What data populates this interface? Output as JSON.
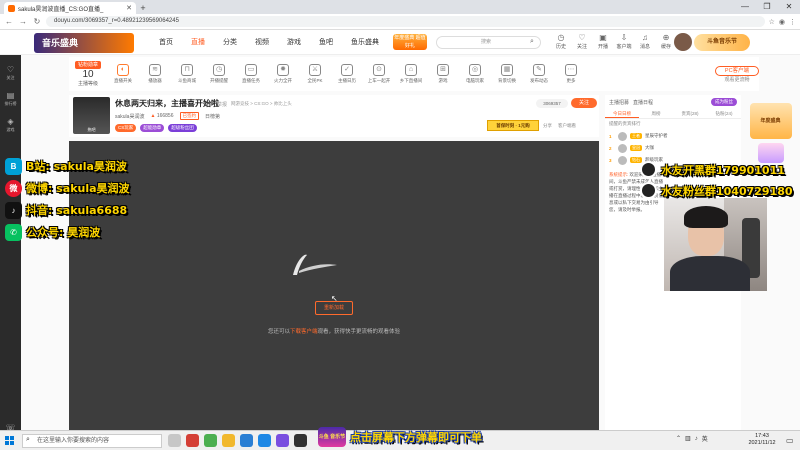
{
  "browser": {
    "tab_title": "sakula昊润波直播_CS:GO直播_",
    "url": "douyu.com/3069357_r=0.489212395690642​45",
    "window_controls": [
      "—",
      "❐",
      "✕"
    ]
  },
  "header": {
    "logo_text": "音乐盛典",
    "nav": [
      "首页",
      "直播",
      "分类",
      "视频",
      "游戏",
      "鱼吧",
      "鱼乐盛典"
    ],
    "promo": "年度盛典 超值好礼",
    "search_placeholder": "搜索",
    "icons": [
      {
        "label": "历史",
        "icon": "clock-icon"
      },
      {
        "label": "关注",
        "icon": "heart-icon"
      },
      {
        "label": "开播",
        "icon": "camera-icon"
      },
      {
        "label": "客户端",
        "icon": "download-icon"
      },
      {
        "label": "消息",
        "icon": "bell-icon"
      },
      {
        "label": "缓存",
        "icon": "cache-icon"
      }
    ],
    "banner": "斗鱼音乐节"
  },
  "leftbar": [
    {
      "label": "关注",
      "icon": "heart-icon"
    },
    {
      "label": "排行榜",
      "icon": "rank-icon"
    },
    {
      "label": "游戏",
      "icon": "game-icon"
    },
    {
      "label": "客服",
      "icon": "service-icon"
    }
  ],
  "toolrow": {
    "level_badge": "钻粉勋章",
    "level_num": "10",
    "level_sub": "主播等级",
    "tools": [
      {
        "label": "直播开关",
        "glyph": "◐",
        "warm": true
      },
      {
        "label": "播放器",
        "glyph": "≋",
        "warm": false
      },
      {
        "label": "斗鱼商城",
        "glyph": "⊓",
        "warm": false
      },
      {
        "label": "开播提醒",
        "glyph": "◷",
        "warm": false
      },
      {
        "label": "直播任务",
        "glyph": "▭",
        "warm": false
      },
      {
        "label": "火力全开",
        "glyph": "✹",
        "warm": false
      },
      {
        "label": "全民PK",
        "glyph": "⚔",
        "warm": false
      },
      {
        "label": "主播日历",
        "glyph": "✓",
        "warm": false
      },
      {
        "label": "上车一起开",
        "glyph": "⊙",
        "warm": false
      },
      {
        "label": "乡下直播间",
        "glyph": "⌂",
        "warm": false
      },
      {
        "label": "游戏",
        "glyph": "⊞",
        "warm": false
      },
      {
        "label": "电脑玩家",
        "glyph": "◎",
        "warm": false
      },
      {
        "label": "背景切换",
        "glyph": "▦",
        "warm": false
      },
      {
        "label": "发布动态",
        "glyph": "✎",
        "warm": false
      },
      {
        "label": "更多",
        "glyph": "⋯",
        "warm": false
      }
    ],
    "pc_button": "PC客户端",
    "pc_sub": "观看更流畅"
  },
  "room": {
    "avatar_label": "热吧",
    "title": "休息两天归来，主播喜开始啦",
    "report": "举报",
    "crumbs": "网游竞技 > CS:GO > 帅比上头",
    "streamer": "sakula昊润波",
    "hot": "166856",
    "verified": "已签约",
    "rank": "日榜第",
    "tags": [
      "CS玩家",
      "超能勋章",
      "超级粉丝团"
    ],
    "room_id": "3069357",
    "follow": "关注",
    "gift_banner": "首保时刻 · 1元购",
    "actions": [
      "分享",
      "客户端看"
    ]
  },
  "player": {
    "reload": "重新加载",
    "tip_prefix": "您还可以",
    "tip_link": "下载客户端",
    "tip_suffix": "观看，获得快手更流畅的观看体验"
  },
  "chat": {
    "top_label": "主播招募",
    "top_right": "直播日程",
    "fans_button": "成为粉丝",
    "tabs": [
      "今日日榜",
      "周榜",
      "贵宾(28)",
      "钻粉(24)"
    ],
    "rank_title": "提醒的贵宾排行",
    "ranks": [
      {
        "rank": "1",
        "name": "星辰守护者",
        "badge": "王者"
      },
      {
        "rank": "2",
        "name": "大咖",
        "badge": "皇冠"
      },
      {
        "rank": "3",
        "name": "超级玩家",
        "badge": "钻石"
      }
    ],
    "sys_label": "系统提示:",
    "sys_text": "欢迎来到本直播间，斗鱼严禁未成年人直播或打赏，请理性消费，如主播在直播过程中发布不良信息或以私下交易为由引导您，请及时举报。"
  },
  "rightbar": {
    "card": "年度盛典",
    "tool": "礼物卡片"
  },
  "overlays": {
    "social": [
      {
        "icon": "bilibili-icon",
        "glyph": "B",
        "cls": "ico-bili",
        "text": "B站: sakula昊润波"
      },
      {
        "icon": "weibo-icon",
        "glyph": "微",
        "cls": "ico-weibo",
        "text": "微博: sakula昊润波"
      },
      {
        "icon": "douyin-icon",
        "glyph": "♪",
        "cls": "ico-douyin",
        "text": "抖音: sakula6688"
      },
      {
        "icon": "wechat-icon",
        "glyph": "✆",
        "cls": "ico-wechat",
        "text": "公众号: 昊润波"
      }
    ],
    "qq": [
      {
        "text": "水友开黑群179901011"
      },
      {
        "text": "水友粉丝群1040729180"
      }
    ],
    "caption_logo": "斗鱼 音乐节",
    "caption": "点击屏幕下方弹幕即可下单"
  },
  "taskbar": {
    "search_placeholder": "在这里输入你要搜索的内容",
    "time": "17:43",
    "date": "2021/11/12",
    "lang": "英",
    "apps": [
      "#c7c7c7",
      "#d43f36",
      "#4caf50",
      "#f1b82d",
      "#2a7fd4",
      "#1e88e5",
      "#7a4fe0",
      "#333333"
    ]
  }
}
